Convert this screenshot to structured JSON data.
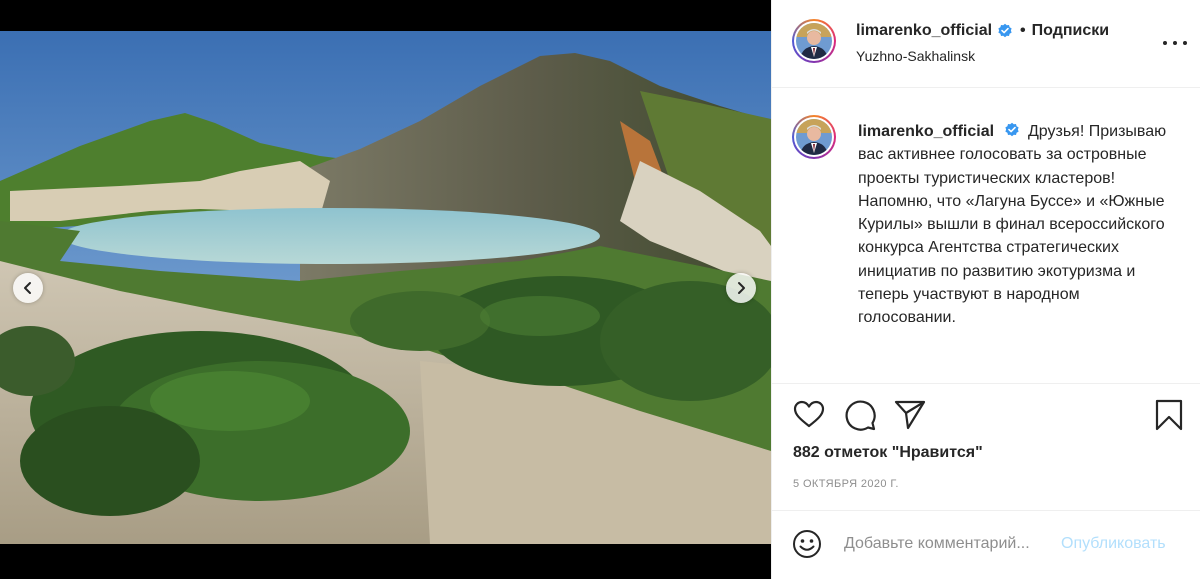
{
  "post": {
    "username": "limarenko_official",
    "separator": "•",
    "follow_label": "Подписки",
    "location": "Yuzhno-Sakhalinsk",
    "caption_text": "Друзья! Призываю вас активнее голосовать за островные проекты туристических кластеров! Напомню, что «Лагуна Буссе» и «Южные Курилы» вышли в финал всероссийского конкурса Агентства стратегических инициатив по развитию экотуризма и теперь участвуют в народном голосовании.",
    "likes": "882 отметок \"Нравится\"",
    "date": "5 ОКТЯБРЯ 2020 Г."
  },
  "comment": {
    "placeholder": "Добавьте комментарий...",
    "publish_label": "Опубликовать"
  },
  "icons": {
    "verified": "verified-badge-icon",
    "more": "more-options-icon",
    "like": "heart-icon",
    "comment": "comment-icon",
    "share": "paper-plane-icon",
    "save": "bookmark-icon",
    "emoji": "smiley-icon",
    "prev": "chevron-left-icon",
    "next": "chevron-right-icon"
  },
  "colors": {
    "verified": "#3897f0",
    "publish_disabled": "#b2dffc",
    "secondary_text": "#8e8e8e"
  }
}
